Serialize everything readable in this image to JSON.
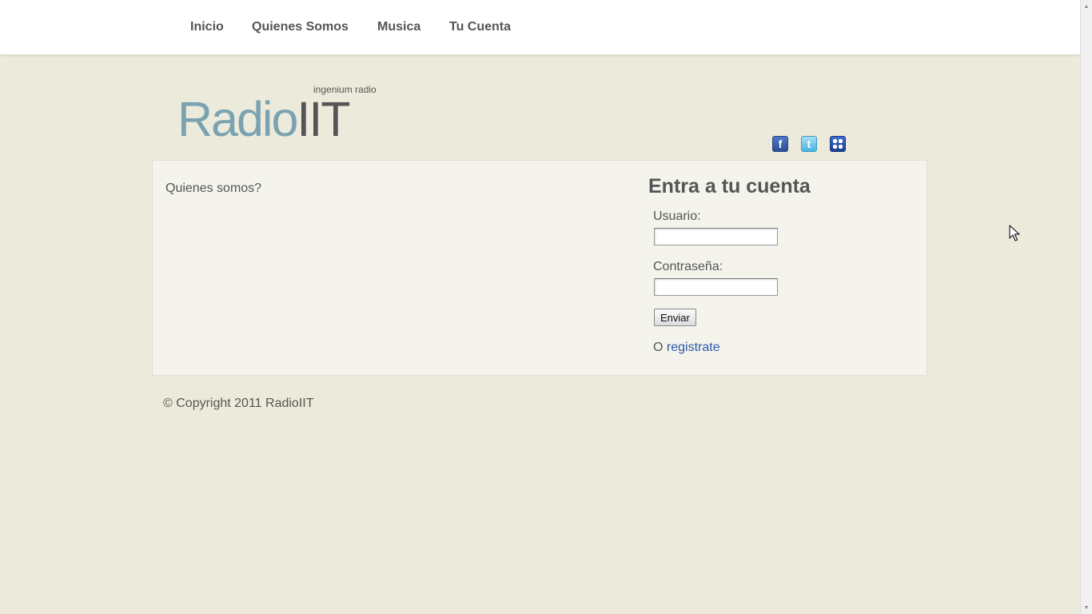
{
  "nav": {
    "items": [
      {
        "label": "Inicio"
      },
      {
        "label": "Quienes Somos"
      },
      {
        "label": "Musica"
      },
      {
        "label": "Tu Cuenta"
      }
    ]
  },
  "header": {
    "tagline": "ingenium radio",
    "logo_part1": "Radio",
    "logo_part2": "IIT"
  },
  "social": {
    "facebook_icon": "facebook-icon",
    "twitter_icon": "twitter-icon",
    "myspace_icon": "myspace-icon",
    "facebook_glyph": "f",
    "twitter_glyph": "t"
  },
  "main": {
    "about_title": "Quienes somos?"
  },
  "login": {
    "title": "Entra a tu cuenta",
    "user_label": "Usuario:",
    "user_value": "",
    "password_label": "Contraseña:",
    "password_value": "",
    "submit_label": "Enviar",
    "register_prefix": "O ",
    "register_link": "registrate"
  },
  "footer": {
    "copyright": "© Copyright 2011 RadioIIT"
  },
  "colors": {
    "background": "#ecebdb",
    "logo_accent": "#7aa2b0",
    "text": "#555555",
    "link": "#2b5aa8"
  }
}
